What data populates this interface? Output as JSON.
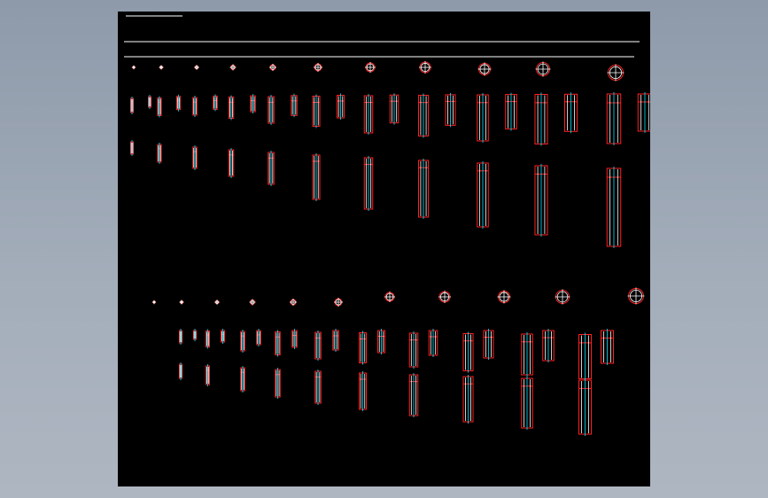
{
  "app": {
    "background_color": "#9aa5b4",
    "viewport_background": "#000000"
  },
  "palette": {
    "outline": "#ff2020",
    "centerline": "#00e5ff",
    "body": "#ffffff",
    "rule": "#ffffff"
  },
  "drawing": {
    "title_text": "",
    "groups": [
      {
        "name": "upper-group",
        "sizes": 12
      },
      {
        "name": "lower-group",
        "sizes": 12
      }
    ]
  }
}
